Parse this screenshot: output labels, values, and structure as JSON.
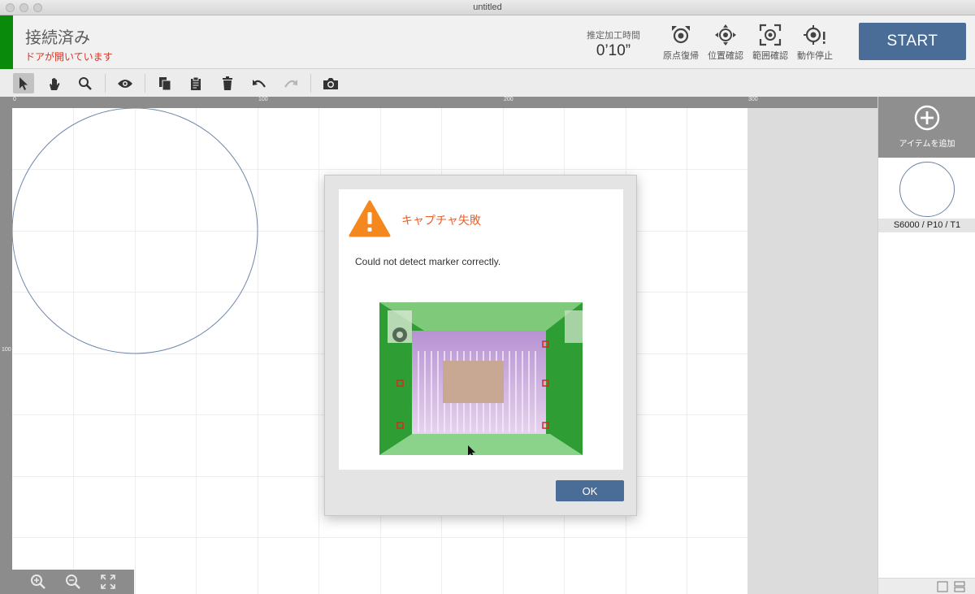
{
  "window": {
    "title": "untitled"
  },
  "header": {
    "connection_status": "接続済み",
    "door_status": "ドアが開いています",
    "estimate_label": "推定加工時間",
    "estimate_value": "0’10”",
    "buttons": [
      {
        "label": "原点復帰",
        "icon": "home-target-icon"
      },
      {
        "label": "位置確認",
        "icon": "move-target-icon"
      },
      {
        "label": "範囲確認",
        "icon": "frame-target-icon"
      },
      {
        "label": "動作停止",
        "icon": "stop-target-icon"
      }
    ],
    "start_label": "START",
    "accent_color": "#0a8a0a",
    "primary_color": "#4a6d98"
  },
  "toolbar": {
    "tools": [
      "select-arrow-icon",
      "hand-icon",
      "zoom-icon",
      "eye-icon",
      "copy-icon",
      "clipboard-icon",
      "trash-icon",
      "undo-icon",
      "redo-icon",
      "camera-icon"
    ],
    "active_tool": "select-arrow-icon"
  },
  "rulers": {
    "top_ticks": [
      "0",
      "100",
      "200",
      "300"
    ],
    "left_ticks": [
      "100"
    ]
  },
  "right_panel": {
    "add_label": "アイテムを追加",
    "items": [
      {
        "label": "S6000 / P10 / T1"
      }
    ]
  },
  "dialog": {
    "title": "キャプチャ失敗",
    "message": "Could not detect marker correctly.",
    "ok_label": "OK",
    "title_color": "#e8612e",
    "warning_color": "#f5871f"
  }
}
